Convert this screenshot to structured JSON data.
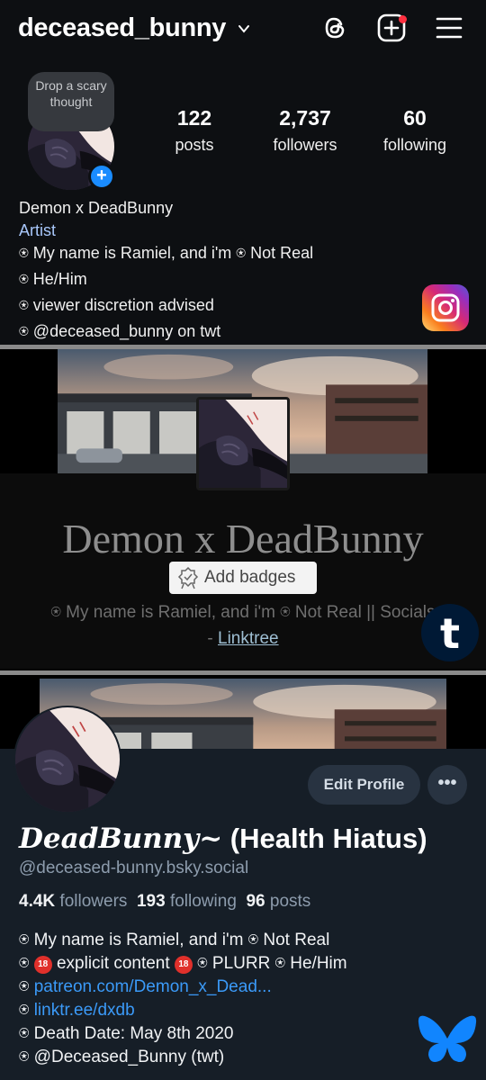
{
  "instagram": {
    "username": "deceased_bunny",
    "note": "Drop a scary thought",
    "stats": [
      {
        "number": "122",
        "label": "posts"
      },
      {
        "number": "2,737",
        "label": "followers"
      },
      {
        "number": "60",
        "label": "following"
      }
    ],
    "name": "Demon x DeadBunny",
    "category": "Artist",
    "bio": [
      "⍟ My name is Ramiel, and i'm ⍟ Not Real",
      "⍟ He/Him",
      "⍟ viewer discretion advised",
      "⍟ @deceased_bunny on twt"
    ],
    "icons": [
      "chevron-down-icon",
      "threads-icon",
      "new-post-icon",
      "menu-icon",
      "instagram-logo"
    ],
    "colors": {
      "background": "#0d0f12",
      "notification_dot": "#ff3040",
      "category": "#a8c7fa",
      "add_story": "#1a8cff"
    }
  },
  "tumblr": {
    "title": "Demon x DeadBunny",
    "badge_label": "Add badges",
    "description": "⍟ My name is Ramiel, and i'm ⍟ Not Real || Socials",
    "description_prefix": "- ",
    "link_label": "Linktree",
    "logo_letter": "t",
    "colors": {
      "logo_bg": "#001935",
      "title": "#8e8e8e",
      "link": "#9fbfd3"
    }
  },
  "bluesky": {
    "edit_label": "Edit Profile",
    "more_label": "•••",
    "display_name_script": "DeadBunny~",
    "display_name_rest": " (Health Hiatus)",
    "handle": "@deceased-bunny.bsky.social",
    "stats": [
      {
        "number": "4.4K",
        "label": "followers"
      },
      {
        "number": "193",
        "label": "following"
      },
      {
        "number": "96",
        "label": "posts"
      }
    ],
    "bio": {
      "line1": "⍟ My name is Ramiel, and i'm ⍟ Not Real",
      "line2_start": "⍟ ",
      "age_mark": "18",
      "line2_mid": " explicit content ",
      "line2_end": " ⍟ PLURR ⍟ He/Him",
      "line3_prefix": "⍟ ",
      "line3_link": "patreon.com/Demon_x_Dead...",
      "line4_prefix": "⍟ ",
      "line4_link": "linktr.ee/dxdb",
      "line5": "⍟ Death Date: May 8th 2020",
      "line6": "⍟ @Deceased_Bunny (twt)"
    },
    "colors": {
      "background": "#161e27",
      "link": "#3b9af8",
      "butterfly": "#1185fe"
    }
  }
}
